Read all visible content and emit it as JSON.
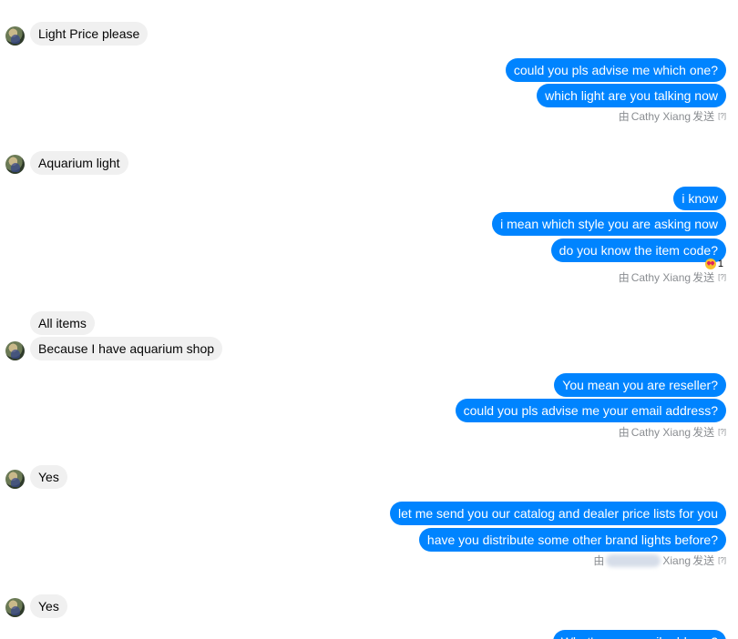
{
  "messages": {
    "m1": "Light Price please",
    "m2": "could you pls advise me which one?",
    "m3": "which light are you talking now",
    "m4": "Aquarium light",
    "m5": "i know",
    "m6": "i mean which style you are asking now",
    "m7": "do you know the item code?",
    "m8": "All items",
    "m9": "Because I have aquarium shop",
    "m10": "You mean you are reseller?",
    "m11": "could you pls advise me your email address?",
    "m12": "Yes",
    "m13": "let me send you our catalog and dealer price lists for you",
    "m14": "have you distribute some other brand lights before?",
    "m15": "Yes",
    "m16": "What's your email address?"
  },
  "sender_notes": {
    "n1": {
      "prefix": "由",
      "name": "Cathy Xiang",
      "suffix": "发送",
      "help": "[?]"
    },
    "n2": {
      "prefix": "由",
      "name": "Cathy Xiang",
      "suffix": "发送",
      "help": "[?]"
    },
    "n3": {
      "prefix": "由",
      "name": "Cathy Xiang",
      "suffix": "发送",
      "help": "[?]"
    },
    "n4": {
      "prefix": "由",
      "name": "Xiang",
      "suffix": "发送",
      "help": "[?]"
    }
  },
  "reaction": {
    "emoji": "heart-eyes-icon",
    "count": "1"
  },
  "colors": {
    "outgoing": "#0084ff",
    "incoming": "#f0f0f0",
    "meta": "#8a8d91"
  }
}
